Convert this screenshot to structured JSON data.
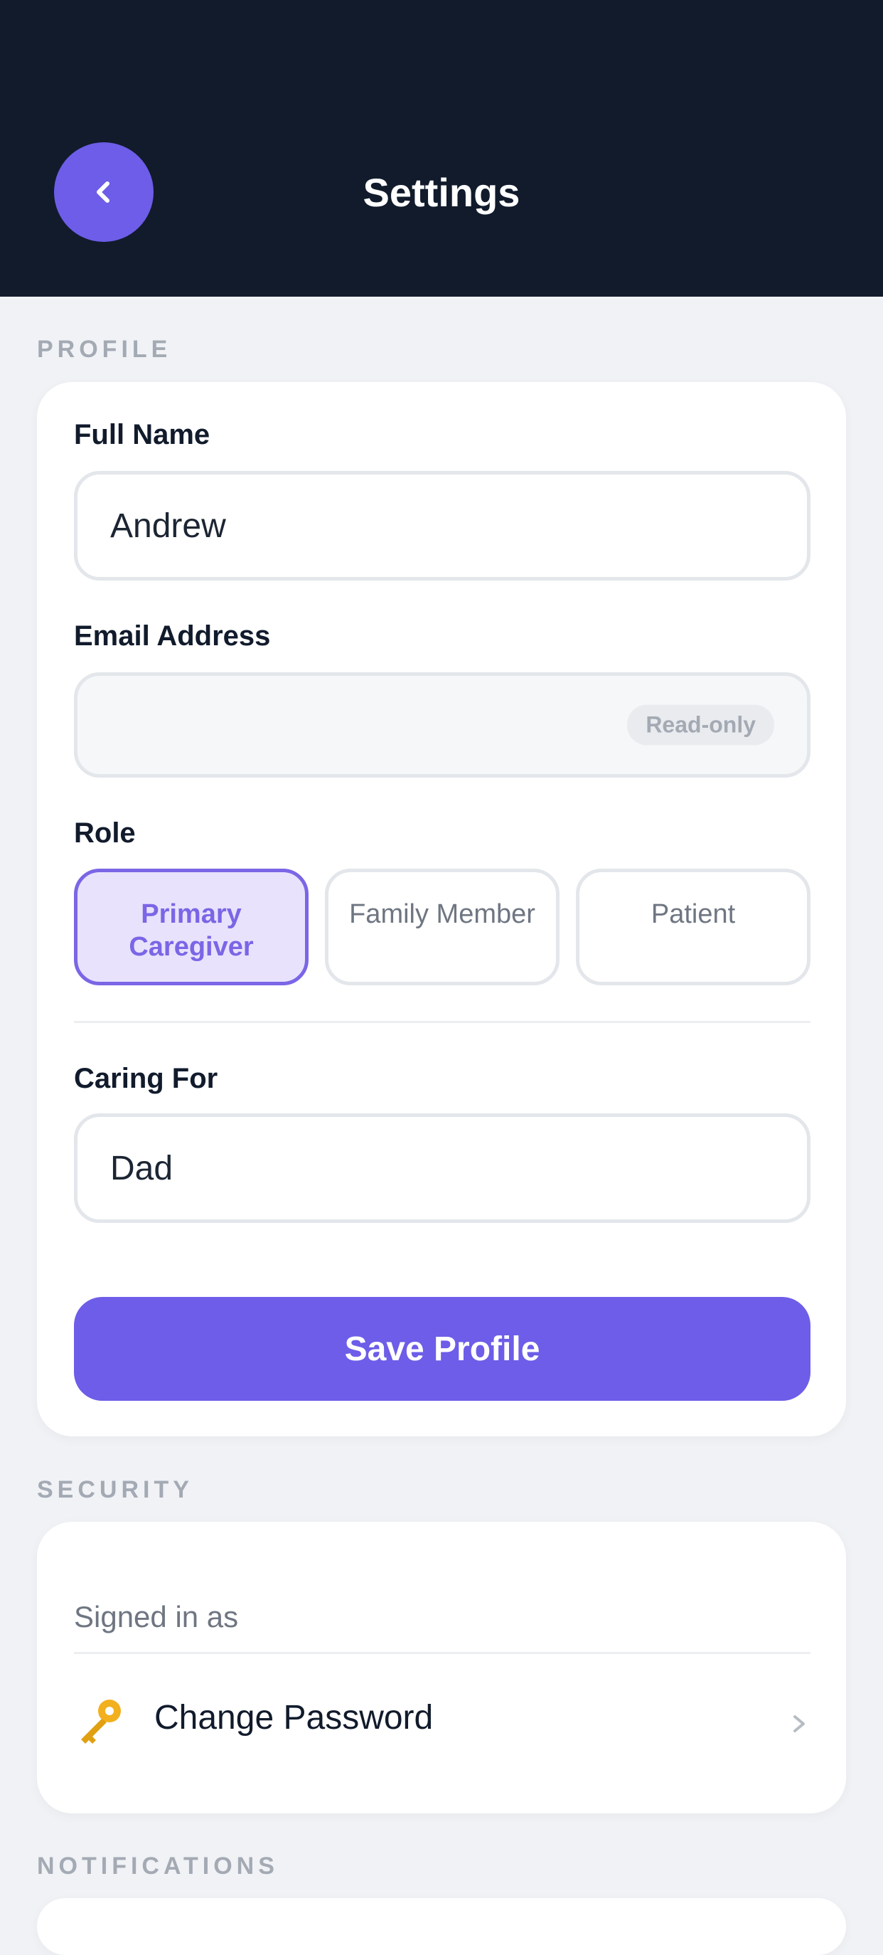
{
  "header": {
    "title": "Settings",
    "back_icon": "chevron-left-icon",
    "background": "#111b2c",
    "accent": "#6d5de8"
  },
  "profile": {
    "section_label": "PROFILE",
    "full_name": {
      "label": "Full Name",
      "value": "Andrew"
    },
    "email": {
      "label": "Email Address",
      "value": "",
      "badge": "Read-only"
    },
    "role": {
      "label": "Role",
      "options": [
        {
          "line1": "Primary",
          "line2": "Caregiver",
          "selected": true
        },
        {
          "line1": "Family Member",
          "line2": "",
          "selected": false
        },
        {
          "line1": "Patient",
          "line2": "",
          "selected": false
        }
      ]
    },
    "caring_for": {
      "label": "Caring For",
      "value": "Dad"
    },
    "save_label": "Save Profile"
  },
  "security": {
    "section_label": "SECURITY",
    "signed_in_label": "Signed in as",
    "change_password": {
      "label": "Change Password",
      "icon": "key-icon"
    }
  },
  "notifications": {
    "section_label": "NOTIFICATIONS"
  }
}
